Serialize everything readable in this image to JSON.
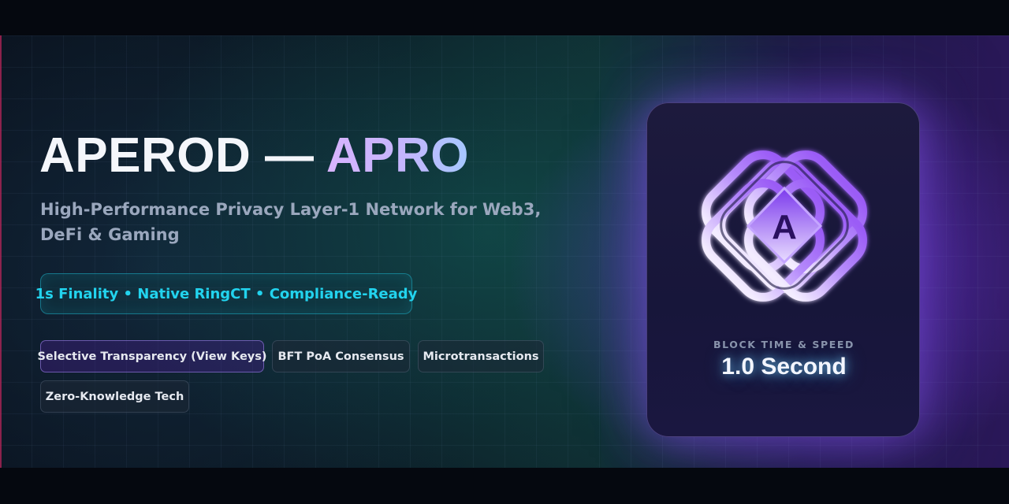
{
  "hero": {
    "title_main": "APEROD — ",
    "title_accent": "APRO",
    "subtitle": "High-Performance Privacy Layer-1 Network for Web3, DeFi & Gaming",
    "highlight": "1s Finality • Native RingCT • Compliance-Ready",
    "tags": [
      "Selective Transparency (View Keys)",
      "BFT PoA Consensus",
      "Microtransactions",
      "Zero-Knowledge Tech"
    ]
  },
  "card": {
    "logo_icon": "aperod-knot-logo-icon",
    "logo_letter": "A",
    "label": "BLOCK TIME & SPEED",
    "value": "1.0 Second"
  },
  "colors": {
    "accent_purple": "#a78bfa",
    "accent_cyan": "#22d3ee",
    "background": "#0a111d"
  }
}
